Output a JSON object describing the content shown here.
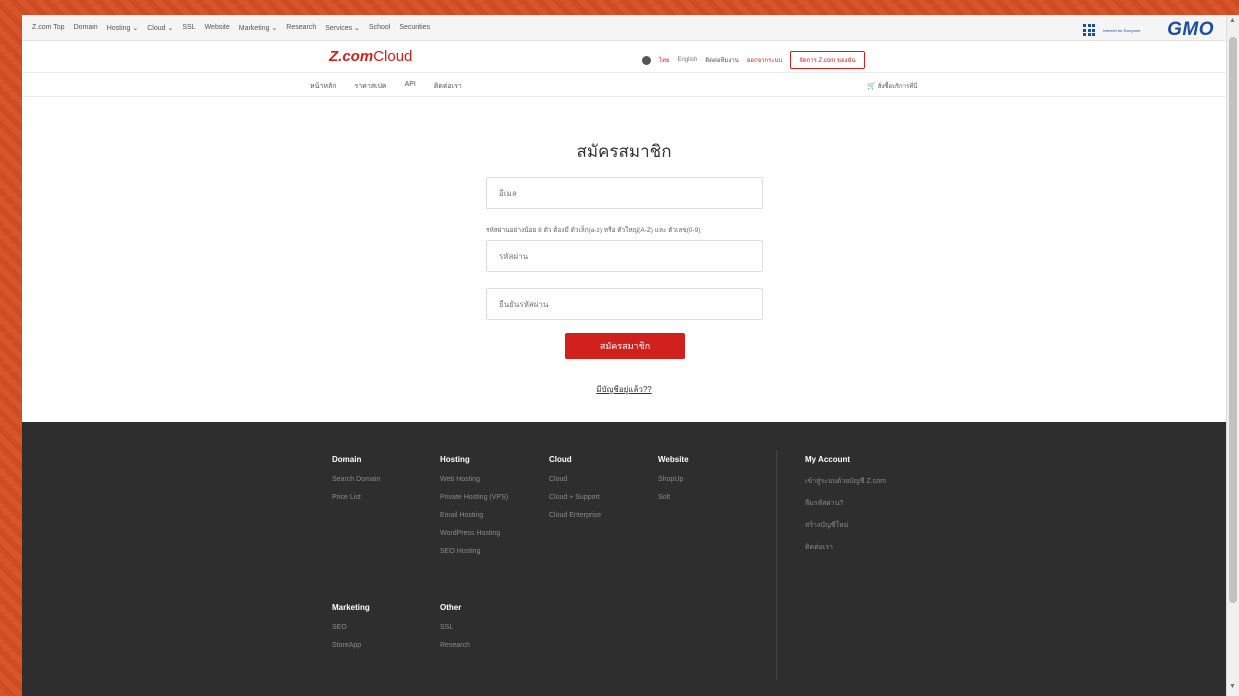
{
  "gmo_bar": {
    "nav": [
      "Z.com Top",
      "Domain",
      "Hosting ⌄",
      "Cloud ⌄",
      "SSL",
      "Website",
      "Marketing ⌄",
      "Research",
      "Services ⌄",
      "School",
      "Securities"
    ],
    "tagline": "Internet for Everyone",
    "logo": "GMO"
  },
  "header": {
    "logo_bold": "Z.com",
    "logo_light": "Cloud",
    "lang_th": "ไทย",
    "lang_en": "English",
    "contact": "ติดต่อทีมงาน",
    "logout": "ออกจากระบบ",
    "member_button": "จัดการ Z.com ของฉัน"
  },
  "subnav": {
    "items": [
      "หน้าหลัก",
      "ราคาสเปค",
      "API",
      "ติดต่อเรา"
    ],
    "cart": "สั่งซื้อบริการที่นี่"
  },
  "form": {
    "title": "สมัครสมาชิก",
    "email_placeholder": "อีเมล",
    "password_hint": "รหัสผ่านอย่างน้อย 8 ตัว ต้องมี ตัวเล็ก(a-z) หรือ ตัวใหญ่(A-Z) และ ตัวเลข(0-9)",
    "password_placeholder": "รหัสผ่าน",
    "confirm_placeholder": "ยืนยันรหัสผ่าน",
    "submit_label": "สมัครสมาชิก",
    "have_account": "มีบัญชีอยู่แล้ว??"
  },
  "footer": {
    "domain": {
      "title": "Domain",
      "links": [
        "Search Domain",
        "Price List"
      ]
    },
    "hosting": {
      "title": "Hosting",
      "links": [
        "Web Hosting",
        "Private Hosting (VPS)",
        "Email Hosting",
        "WordPress Hosting",
        "SEO Hosting"
      ]
    },
    "cloud": {
      "title": "Cloud",
      "links": [
        "Cloud",
        "Cloud + Support",
        "Cloud Enterprise"
      ]
    },
    "website": {
      "title": "Website",
      "links": [
        "ShopUp",
        "Solt"
      ]
    },
    "account": {
      "title": "My Account",
      "links": [
        "เข้าสู่ระบบด้วยบัญชี Z.com",
        "ลืมรหัสผ่าน?",
        "สร้างบัญชีใหม่",
        "ติดต่อเรา"
      ]
    },
    "marketing": {
      "title": "Marketing",
      "links": [
        "SEO",
        "StoreApp"
      ]
    },
    "other": {
      "title": "Other",
      "links": [
        "SSL",
        "Research"
      ]
    }
  },
  "colors": {
    "brand_red": "#d0211c",
    "gmo_blue": "#1d4e9b",
    "footer_bg": "#2e2e2e",
    "background": "#d9542a"
  }
}
